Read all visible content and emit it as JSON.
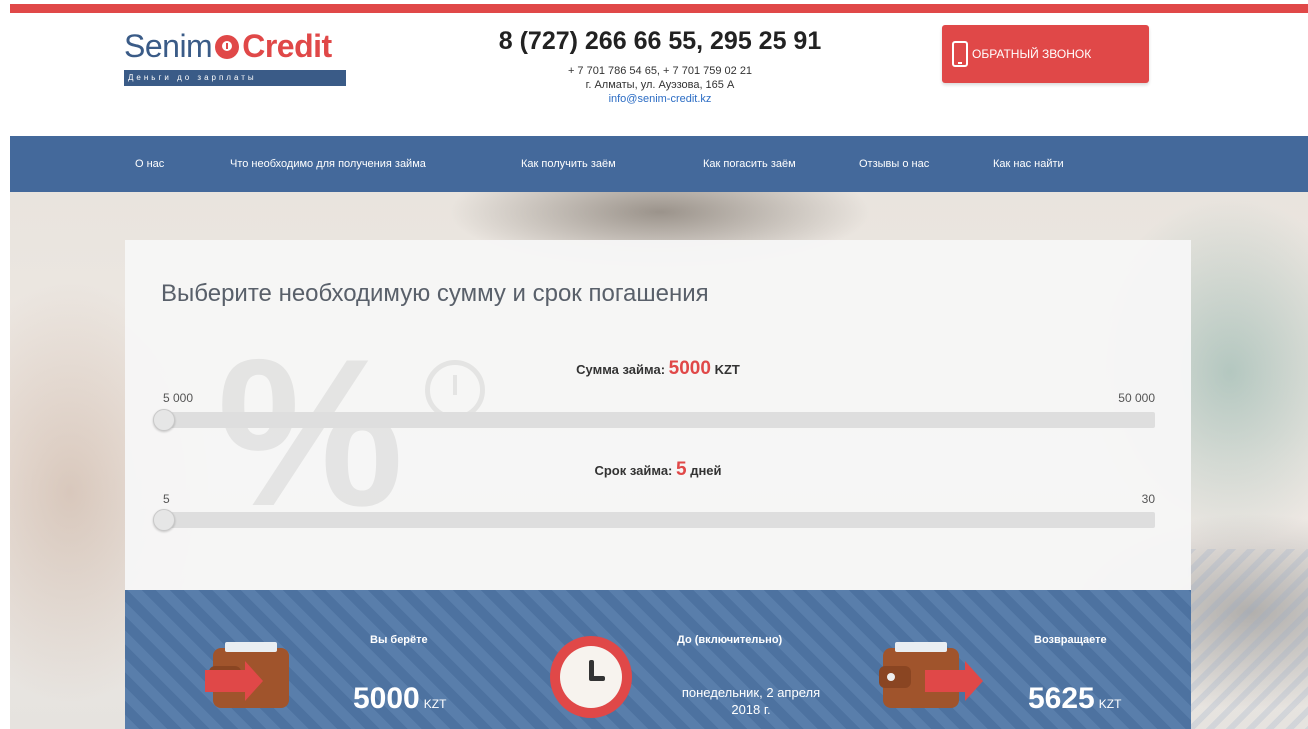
{
  "colors": {
    "accent": "#e04848",
    "nav": "#44699b",
    "brand": "#3a5b87"
  },
  "logo": {
    "senim": "Senim",
    "credit": "Credit",
    "tagline": "Деньги до зарплаты"
  },
  "header": {
    "phone_main": "8 (727) 266 66 55, 295 25 91",
    "phones_sub": "+ 7 701 786 54 65, + 7 701 759 02 21",
    "address": "г. Алматы, ул. Ауэзова, 165 А",
    "email": "info@senim-credit.kz",
    "callback_label": "ОБРАТНЫЙ ЗВОНОК",
    "callback_icon": "mobile-phone-icon"
  },
  "nav": {
    "items": [
      {
        "label": "О нас"
      },
      {
        "label": "Что необходимо для получения займа"
      },
      {
        "label": "Как получить заём"
      },
      {
        "label": "Как погасить заём"
      },
      {
        "label": "Отзывы о нас"
      },
      {
        "label": "Как нас найти"
      }
    ]
  },
  "calculator": {
    "title": "Выберите необходимую сумму и срок погашения",
    "amount": {
      "label": "Сумма займа:",
      "value": "5000",
      "unit": "KZT",
      "min": "5 000",
      "max": "50 000",
      "position": 0
    },
    "term": {
      "label": "Срок займа:",
      "value": "5",
      "unit": "дней",
      "min": "5",
      "max": "30",
      "position": 0
    }
  },
  "results": {
    "take_title": "Вы берёте",
    "take_value": "5000",
    "take_unit": "KZT",
    "until_title": "До (включительно)",
    "until_date": "понедельник, 2 апреля 2018 г.",
    "return_title": "Возвращаете",
    "return_value": "5625",
    "return_unit": "KZT"
  }
}
